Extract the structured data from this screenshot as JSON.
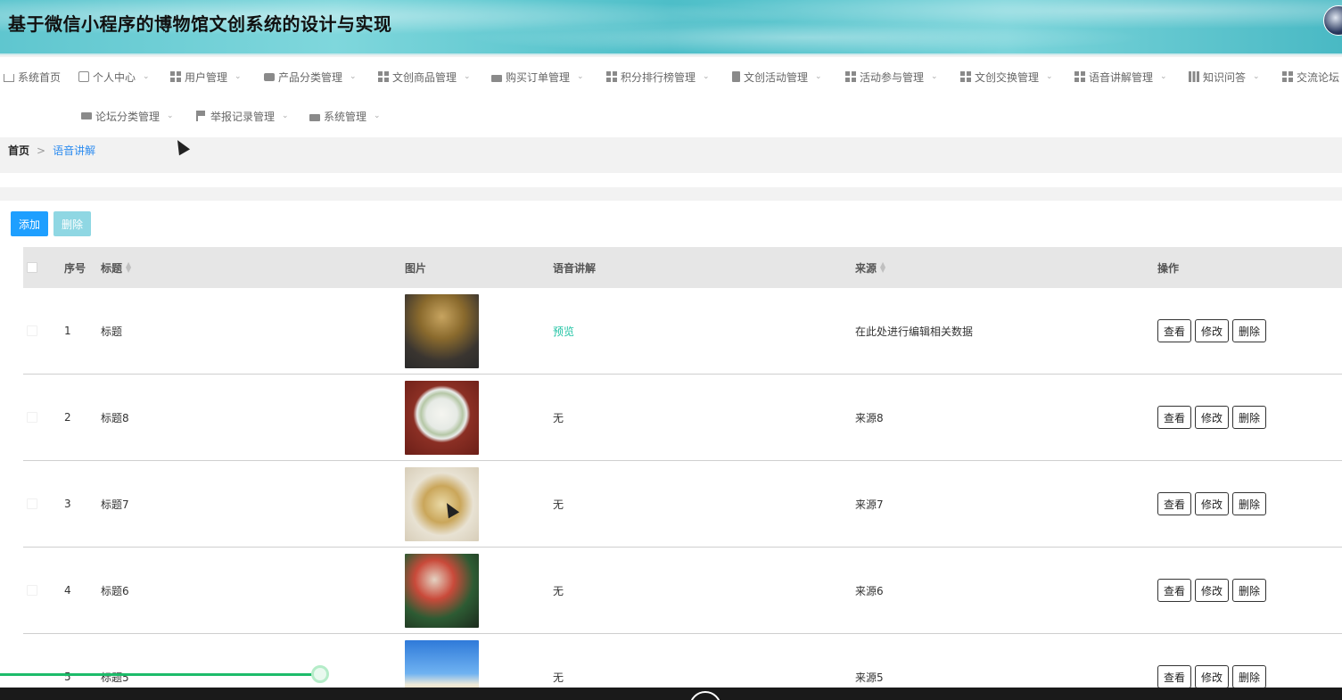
{
  "header": {
    "title": "基于微信小程序的博物馆文创系统的设计与实现"
  },
  "nav": {
    "items": [
      {
        "label": "系统首页",
        "icon": "home-icon"
      },
      {
        "label": "个人中心",
        "icon": "card-icon"
      },
      {
        "label": "用户管理",
        "icon": "grid-icon"
      },
      {
        "label": "产品分类管理",
        "icon": "chat-icon"
      },
      {
        "label": "文创商品管理",
        "icon": "grid-icon"
      },
      {
        "label": "购买订单管理",
        "icon": "bag-icon"
      },
      {
        "label": "积分排行榜管理",
        "icon": "grid-icon"
      },
      {
        "label": "文创活动管理",
        "icon": "clipboard-icon"
      },
      {
        "label": "活动参与管理",
        "icon": "grid-icon"
      },
      {
        "label": "文创交换管理",
        "icon": "grid9-icon"
      },
      {
        "label": "语音讲解管理",
        "icon": "grid-icon"
      },
      {
        "label": "知识问答",
        "icon": "bars-icon"
      },
      {
        "label": "交流论坛",
        "icon": "grid-icon"
      },
      {
        "label": "论坛分类管理",
        "icon": "monitor-icon"
      },
      {
        "label": "举报记录管理",
        "icon": "flag-icon"
      },
      {
        "label": "系统管理",
        "icon": "briefcase-icon"
      }
    ]
  },
  "breadcrumb": {
    "home": "首页",
    "separator": ">",
    "current": "语音讲解"
  },
  "toolbar": {
    "add_label": "添加",
    "delete_label": "删除"
  },
  "table": {
    "headers": {
      "index": "序号",
      "title": "标题",
      "image": "图片",
      "audio": "语音讲解",
      "source": "来源",
      "actions": "操作"
    },
    "rows": [
      {
        "index": "1",
        "title": "标题",
        "audio": "预览",
        "audio_is_link": true,
        "source": "在此处进行编辑相关数据"
      },
      {
        "index": "2",
        "title": "标题8",
        "audio": "无",
        "audio_is_link": false,
        "source": "来源8"
      },
      {
        "index": "3",
        "title": "标题7",
        "audio": "无",
        "audio_is_link": false,
        "source": "来源7"
      },
      {
        "index": "4",
        "title": "标题6",
        "audio": "无",
        "audio_is_link": false,
        "source": "来源6"
      },
      {
        "index": "5",
        "title": "标题5",
        "audio": "无",
        "audio_is_link": false,
        "source": "来源5"
      }
    ],
    "action_labels": {
      "view": "查看",
      "edit": "修改",
      "delete": "删除"
    }
  },
  "colors": {
    "accent": "#1e9fff",
    "preview_link": "#20c3a4",
    "progress": "#1dbb6a"
  }
}
